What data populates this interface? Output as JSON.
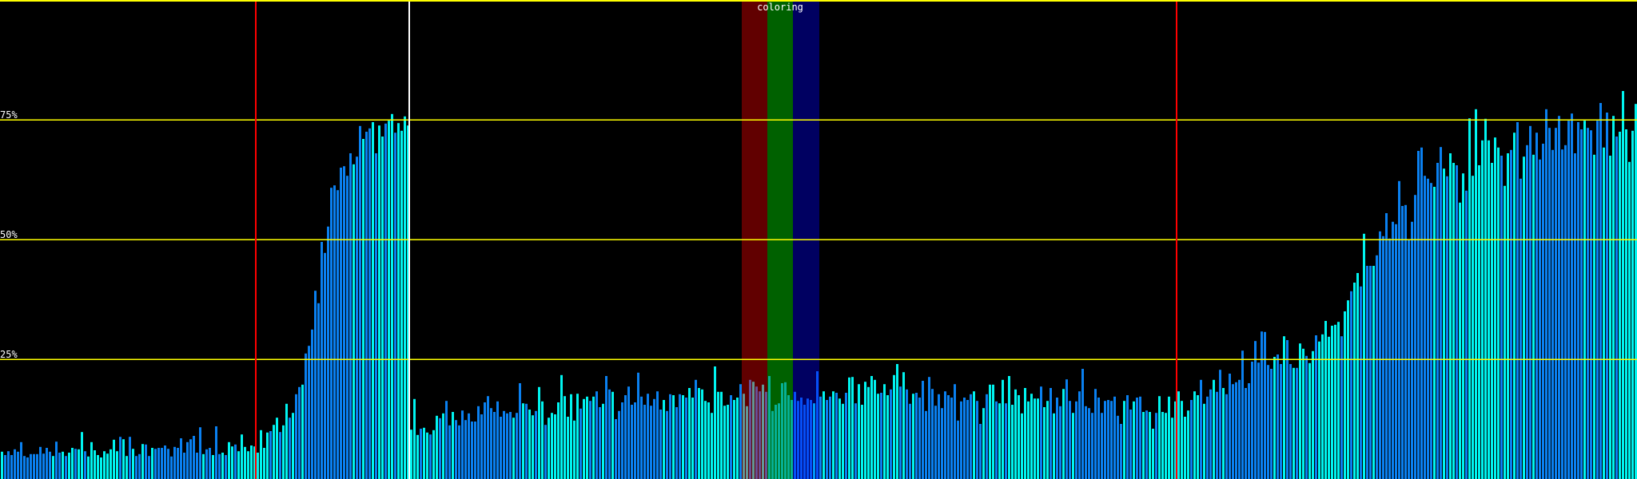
{
  "chart_data": {
    "type": "bar",
    "title": "coloring",
    "ylim": [
      0,
      100
    ],
    "ytick_labels": [
      "25%",
      "50%",
      "75%"
    ],
    "yticks": [
      25,
      50,
      75
    ],
    "grid": true,
    "colors": {
      "bar_a": "#00f4f0",
      "bar_b": "#0a80f0",
      "grid": "#ffff00",
      "marker_red": "#ff0000",
      "marker_white": "#ffffff"
    },
    "markers": [
      {
        "name": "red-marker-1",
        "bar_index": 80,
        "color": "#ff0000"
      },
      {
        "name": "white-marker",
        "bar_index": 128,
        "color": "#ffffff"
      },
      {
        "name": "red-marker-2",
        "bar_index": 368,
        "color": "#ff0000"
      }
    ],
    "coloring_bands": [
      {
        "name": "red",
        "from_bar": 232,
        "to_bar": 240,
        "color": "rgba(255,0,0,0.38)"
      },
      {
        "name": "green",
        "from_bar": 240,
        "to_bar": 248,
        "color": "rgba(0,255,0,0.38)"
      },
      {
        "name": "blue",
        "from_bar": 248,
        "to_bar": 256,
        "color": "rgba(0,0,255,0.38)"
      }
    ],
    "values": [
      5.7,
      5,
      5.8,
      5,
      6.2,
      5.7,
      7.7,
      4.8,
      4.5,
      5.2,
      5.2,
      5.2,
      6.7,
      5.3,
      6.5,
      5.7,
      4.8,
      7.8,
      5.5,
      5.7,
      4.8,
      5.5,
      6.5,
      6.3,
      6.2,
      9.8,
      5.8,
      4.7,
      7.7,
      6,
      5,
      4.5,
      5.8,
      5.3,
      6.2,
      8.2,
      5.8,
      8.8,
      8.3,
      4.8,
      8.8,
      6.3,
      4.8,
      5.2,
      7.3,
      7.2,
      4.8,
      6.5,
      6.3,
      6.5,
      6.5,
      7,
      6.3,
      4.7,
      6.7,
      6.5,
      8.5,
      5.5,
      7.7,
      8.3,
      9,
      5.5,
      10.8,
      5.2,
      6.2,
      6.5,
      5,
      11,
      5.2,
      5.5,
      5,
      7.7,
      6.8,
      7.2,
      5.8,
      9.3,
      6.7,
      5.8,
      7,
      6.8,
      5.5,
      10.2,
      6.5,
      9.7,
      10,
      11.3,
      12.8,
      9.8,
      11.2,
      15.7,
      12.8,
      13.8,
      17.7,
      19.2,
      19.7,
      26.2,
      27.8,
      31.2,
      39.3,
      36.7,
      49.5,
      47.2,
      52.7,
      60.8,
      61.3,
      60.3,
      65,
      65.3,
      63.3,
      68,
      65.7,
      67.3,
      73.7,
      71,
      72.5,
      73.2,
      74.5,
      68,
      73.8,
      71.5,
      74.2,
      74.8,
      76.2,
      72.3,
      74.3,
      72.7,
      75.7,
      73.8,
      10.3,
      16.7,
      9.2,
      10.5,
      10.7,
      9.7,
      9.3,
      10.2,
      13.2,
      12.7,
      13.7,
      16.3,
      11.2,
      14,
      12.3,
      11.2,
      14.3,
      12.3,
      13.7,
      12,
      12,
      15.2,
      13.5,
      16,
      17.3,
      14.8,
      14,
      16.2,
      13,
      14.2,
      13.7,
      14,
      12.8,
      13.8,
      20,
      15.8,
      15.7,
      14.5,
      13.3,
      14.2,
      19.2,
      16.2,
      11.3,
      12.8,
      13.8,
      13.5,
      16,
      21.7,
      17.3,
      13,
      17.7,
      12.2,
      17.8,
      14.7,
      16.7,
      17.2,
      16.3,
      17.2,
      18.3,
      15,
      15.7,
      21.5,
      18.7,
      18.2,
      12.5,
      14.2,
      16,
      17.5,
      19.3,
      15.5,
      16,
      22.2,
      17.2,
      15.5,
      17.8,
      15.3,
      16.7,
      18.3,
      14.5,
      16.5,
      14.2,
      17.7,
      17.5,
      15,
      17.7,
      17.5,
      17,
      19,
      17,
      20.7,
      19,
      18.7,
      16.3,
      16,
      13.8,
      23.5,
      18.2,
      18.2,
      15.3,
      15.5,
      17.5,
      16.5,
      17,
      19.8,
      17.8,
      15.2,
      20.7,
      20.3,
      19.3,
      18.3,
      19.7,
      18.2,
      21.5,
      14.2,
      15.5,
      15.8,
      20,
      20.2,
      17.5,
      16.5,
      18.2,
      16.3,
      17,
      15.5,
      16.8,
      16.5,
      15.8,
      22.5,
      17.2,
      18.3,
      16.5,
      17.2,
      18.3,
      18,
      16.8,
      15.7,
      18,
      21.2,
      21.3,
      15.8,
      19.8,
      15.5,
      20.3,
      19.2,
      21.5,
      20.7,
      17.8,
      18,
      19.8,
      17.5,
      18.7,
      21.7,
      24,
      19.3,
      22.3,
      18.7,
      15.7,
      17.8,
      18,
      17,
      20.5,
      14.2,
      21.3,
      18.8,
      15.3,
      17.7,
      14.8,
      18.3,
      17.5,
      17,
      19.8,
      12.2,
      16.2,
      17,
      16.5,
      17.7,
      18.3,
      16.3,
      11.5,
      14.8,
      17.7,
      19.7,
      19.7,
      16.2,
      15.8,
      20.7,
      15.8,
      21.5,
      15.5,
      18.7,
      17.5,
      13.7,
      19,
      16.2,
      17.8,
      16.8,
      16.8,
      19.3,
      15,
      16.3,
      19,
      13.7,
      17,
      15.2,
      18.8,
      20.8,
      16.3,
      13.8,
      16.2,
      18.3,
      23,
      15.2,
      14.8,
      13.8,
      18.8,
      17,
      13.8,
      16.3,
      16.5,
      16.3,
      17.2,
      13.2,
      11.5,
      16.3,
      17.5,
      14.5,
      16.2,
      17,
      17.2,
      14,
      14.3,
      14,
      10.5,
      13.8,
      17.3,
      14,
      13.8,
      17.2,
      12.8,
      16.2,
      18.3,
      16.3,
      13,
      14.3,
      16.5,
      18.3,
      17.5,
      20.7,
      15.7,
      17.2,
      18.7,
      20.7,
      18.2,
      22.8,
      19,
      17.7,
      22,
      19.8,
      20.2,
      20.7,
      26.8,
      19,
      20,
      24.5,
      28.8,
      24.3,
      30.8,
      30.7,
      23.8,
      23,
      25.5,
      26,
      24,
      29.8,
      29,
      24,
      23.2,
      23.2,
      28.3,
      27.2,
      25.7,
      24.2,
      26.7,
      30,
      28.7,
      30.2,
      33,
      29.7,
      32,
      32.2,
      32.8,
      29.8,
      35,
      37.3,
      39.2,
      41,
      43,
      40.2,
      51.2,
      44.5,
      44.5,
      44.5,
      46.7,
      51.7,
      50.7,
      55.5,
      50.2,
      53.7,
      53.2,
      62.2,
      57,
      57.2,
      50,
      53.7,
      59.3,
      68.5,
      69.2,
      63.3,
      62.7,
      61.8,
      61,
      66,
      69.3,
      64.8,
      63.2,
      68,
      66,
      65.5,
      57.7,
      63.8,
      60.2,
      75.3,
      63.3,
      77.2,
      65.5,
      70.7,
      75.2,
      70.7,
      66,
      71.3,
      69.2,
      67.5,
      61.2,
      68,
      68.7,
      72.3,
      74.5,
      62.7,
      67.3,
      69.7,
      73.7,
      67.7,
      72.3,
      66.7,
      70,
      77.2,
      73.3,
      68.7,
      73.3,
      75.8,
      68.8,
      69.7,
      74.8,
      76.3,
      68,
      74.5,
      73,
      74.8,
      73.3,
      72.8,
      67.7,
      74.8,
      78.5,
      69.2,
      76.5,
      67.5,
      75.8,
      71.5,
      72.5,
      81,
      73,
      66.2,
      72.7,
      78.3
    ]
  }
}
